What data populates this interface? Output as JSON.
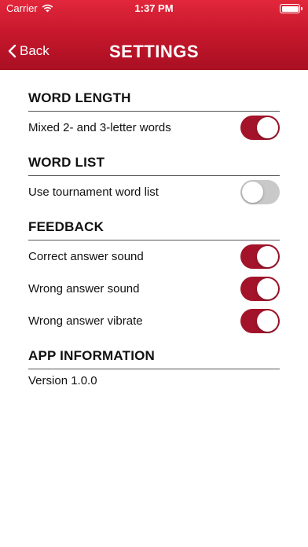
{
  "status_bar": {
    "carrier": "Carrier",
    "time": "1:37 PM"
  },
  "nav": {
    "back_label": "Back",
    "title": "SETTINGS"
  },
  "sections": {
    "word_length": {
      "title": "WORD LENGTH",
      "rows": [
        {
          "label": "Mixed 2- and 3-letter words",
          "on": true
        }
      ]
    },
    "word_list": {
      "title": "WORD LIST",
      "rows": [
        {
          "label": "Use tournament word list",
          "on": false
        }
      ]
    },
    "feedback": {
      "title": "FEEDBACK",
      "rows": [
        {
          "label": "Correct answer sound",
          "on": true
        },
        {
          "label": "Wrong answer sound",
          "on": true
        },
        {
          "label": "Wrong answer vibrate",
          "on": true
        }
      ]
    },
    "app_info": {
      "title": "APP INFORMATION",
      "version": "Version 1.0.0"
    }
  },
  "colors": {
    "header": "#c8182d",
    "toggle_on": "#a3142a",
    "toggle_off": "#c9c9c9"
  }
}
